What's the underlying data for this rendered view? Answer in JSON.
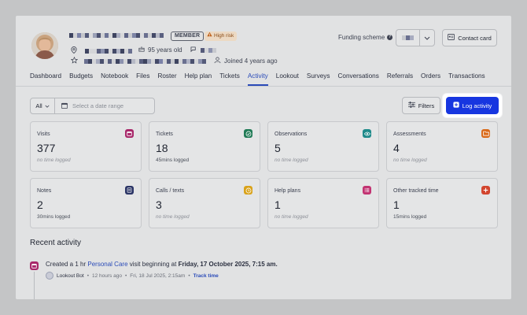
{
  "header": {
    "member_badge": "MEMBER",
    "risk_badge": "High risk",
    "age": "95 years old",
    "joined": "Joined 4 years ago",
    "funding_label": "Funding scheme",
    "funding_help": "?",
    "contact_card": "Contact card"
  },
  "tabs": [
    "Dashboard",
    "Budgets",
    "Notebook",
    "Files",
    "Roster",
    "Help plan",
    "Tickets",
    "Activity",
    "Lookout",
    "Surveys",
    "Conversations",
    "Referrals",
    "Orders",
    "Transactions"
  ],
  "active_tab": "Activity",
  "filters": {
    "all_label": "All",
    "date_placeholder": "Select a date range",
    "filters_button": "Filters",
    "log_button": "Log activity"
  },
  "cards": [
    {
      "title": "Visits",
      "value": "377",
      "sub": "no time logged",
      "muted": true,
      "icon": "calendar-icon",
      "color": "#a8286a"
    },
    {
      "title": "Tickets",
      "value": "18",
      "sub": "45mins logged",
      "muted": false,
      "icon": "check-icon",
      "color": "#1f7a55"
    },
    {
      "title": "Observations",
      "value": "5",
      "sub": "no time logged",
      "muted": true,
      "icon": "eye-icon",
      "color": "#1f8a8a"
    },
    {
      "title": "Assessments",
      "value": "4",
      "sub": "no time logged",
      "muted": true,
      "icon": "folder-icon",
      "color": "#d96a1a"
    },
    {
      "title": "Notes",
      "value": "2",
      "sub": "30mins logged",
      "muted": false,
      "icon": "note-icon",
      "color": "#2b3566"
    },
    {
      "title": "Calls / texts",
      "value": "3",
      "sub": "no time logged",
      "muted": true,
      "icon": "clock-icon",
      "color": "#d9a21a"
    },
    {
      "title": "Help plans",
      "value": "1",
      "sub": "no time logged",
      "muted": true,
      "icon": "list-icon",
      "color": "#c23372"
    },
    {
      "title": "Other tracked time",
      "value": "1",
      "sub": "15mins logged",
      "muted": false,
      "icon": "plus-icon",
      "color": "#d2452e"
    }
  ],
  "recent": {
    "title": "Recent activity",
    "item": {
      "prefix": "Created a 1 hr ",
      "link": "Personal Care",
      "middle": " visit beginning at ",
      "date": "Friday, 17 October 2025, 7:15 am.",
      "author": "Lookout Bot",
      "relative": "12 hours ago",
      "absolute": "Fri, 18 Jul 2025, 2:15am",
      "track": "Track time",
      "sep": "•"
    }
  }
}
